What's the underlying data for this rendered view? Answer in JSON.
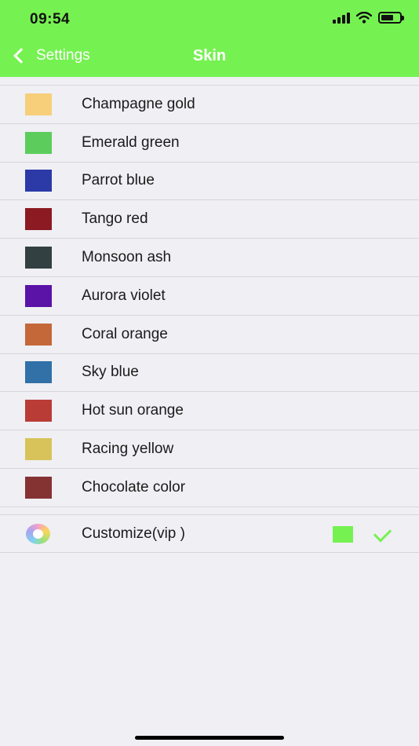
{
  "status_bar": {
    "time": "09:54"
  },
  "nav": {
    "back_label": "Settings",
    "title": "Skin"
  },
  "colors": {
    "header": "#76f152",
    "checkmark": "#76f152"
  },
  "skins": [
    {
      "label": "Champagne gold",
      "color": "#f7cf7b"
    },
    {
      "label": "Emerald green",
      "color": "#5ccd5c"
    },
    {
      "label": "Parrot blue",
      "color": "#2b3aa6"
    },
    {
      "label": "Tango red",
      "color": "#8b1a22"
    },
    {
      "label": "Monsoon ash",
      "color": "#334042"
    },
    {
      "label": "Aurora violet",
      "color": "#5b12a7"
    },
    {
      "label": "Coral orange",
      "color": "#c4683a"
    },
    {
      "label": "Sky blue",
      "color": "#3271a8"
    },
    {
      "label": "Hot sun orange",
      "color": "#b93c37"
    },
    {
      "label": "Racing yellow",
      "color": "#d8c35a"
    },
    {
      "label": "Chocolate color",
      "color": "#853232"
    }
  ],
  "customize": {
    "label": "Customize(vip )",
    "icon": "color-wheel-icon",
    "selected_color": "#76f152",
    "selected": true
  }
}
